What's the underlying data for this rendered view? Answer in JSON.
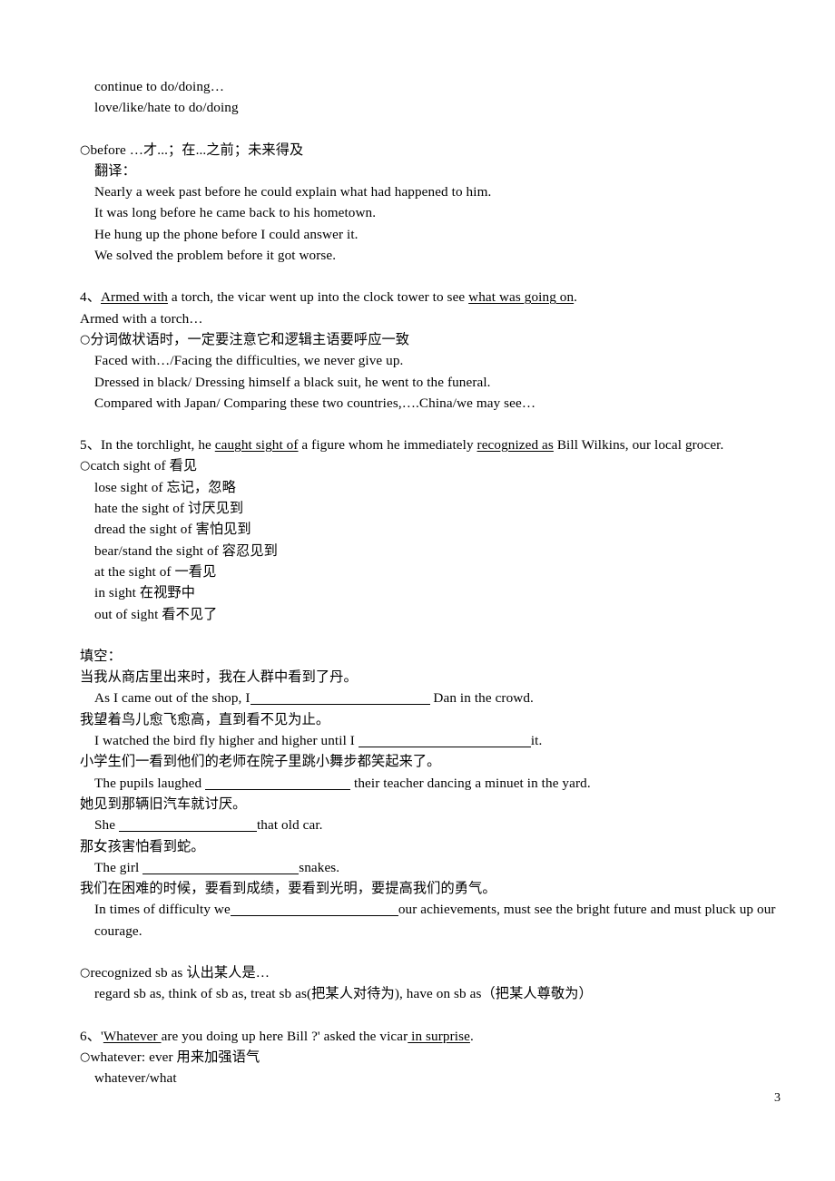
{
  "document": {
    "page_number": "3",
    "blocks": [
      {
        "id": "b1",
        "indent": 1,
        "text": "continue to do/doing…"
      },
      {
        "id": "b2",
        "indent": 1,
        "text": "love/like/hate to do/doing"
      },
      {
        "id": "b3",
        "indent": 0,
        "marker": "○",
        "text": "before …才...；在...之前；未来得及"
      },
      {
        "id": "b4",
        "indent": 1,
        "text": "翻译："
      },
      {
        "id": "b5",
        "indent": 1,
        "text": "Nearly a week past before he could explain what had happened to him."
      },
      {
        "id": "b6",
        "indent": 1,
        "text": "It was long before he came back to his hometown."
      },
      {
        "id": "b7",
        "indent": 1,
        "text": "He hung up the phone before I could answer it."
      },
      {
        "id": "b8",
        "indent": 1,
        "text": "We solved the problem before it got worse."
      },
      {
        "id": "b9",
        "indent": 0,
        "text": "4、Armed with a torch, the vicar went up into the clock tower to see what was going on."
      },
      {
        "id": "b10",
        "indent": 0,
        "text": "Armed with a torch…"
      },
      {
        "id": "b11",
        "indent": 0,
        "marker": "○",
        "text": "分词做状语时，一定要注意它和逻辑主语要呼应一致"
      },
      {
        "id": "b12",
        "indent": 1,
        "text": "Faced with…/Facing the difficulties, we never give up."
      },
      {
        "id": "b13",
        "indent": 1,
        "text": "Dressed in black/ Dressing himself a black suit, he went to the funeral."
      },
      {
        "id": "b14",
        "indent": 1,
        "text": "Compared with Japan/ Comparing these two countries,….China/we may see…"
      },
      {
        "id": "b15",
        "indent": 0,
        "text": "5、In the torchlight, he caught sight of a figure whom he immediately recognized as Bill Wilkins, our local grocer."
      },
      {
        "id": "b16",
        "indent": 0,
        "marker": "○",
        "text": "catch sight of 看见"
      },
      {
        "id": "b17",
        "indent": 1,
        "text": "lose sight of 忘记，忽略"
      },
      {
        "id": "b18",
        "indent": 1,
        "text": "hate the sight of 讨厌见到"
      },
      {
        "id": "b19",
        "indent": 1,
        "text": "dread the sight of 害怕见到"
      },
      {
        "id": "b20",
        "indent": 1,
        "text": "bear/stand the sight of 容忍见到"
      },
      {
        "id": "b21",
        "indent": 1,
        "text": "at the sight of 一看见"
      },
      {
        "id": "b22",
        "indent": 1,
        "text": "in sight 在视野中"
      },
      {
        "id": "b23",
        "indent": 1,
        "text": "out of sight 看不见了"
      },
      {
        "id": "b24",
        "indent": 0,
        "text": "填空："
      },
      {
        "id": "b25",
        "indent": 0,
        "text": "当我从商店里出来时，我在人群中看到了丹。"
      },
      {
        "id": "b26",
        "indent": 1,
        "text": "As I came out of the shop, I"
      },
      {
        "id": "b27",
        "indent": 0,
        "text": "我望着鸟儿愈飞愈高，直到看不见为止。"
      },
      {
        "id": "b28",
        "indent": 1,
        "text": "I watched the bird fly higher and higher until I "
      },
      {
        "id": "b29",
        "indent": 0,
        "text": "小学生们一看到他们的老师在院子里跳小舞步都笑起来了。"
      },
      {
        "id": "b30",
        "indent": 1,
        "text": "The pupils laughed "
      },
      {
        "id": "b31",
        "indent": 0,
        "text": "她见到那辆旧汽车就讨厌。"
      },
      {
        "id": "b32",
        "indent": 1,
        "text": "She "
      },
      {
        "id": "b33",
        "indent": 0,
        "text": "那女孩害怕看到蛇。"
      },
      {
        "id": "b34",
        "indent": 1,
        "text": "The girl "
      },
      {
        "id": "b35",
        "indent": 0,
        "text": "我们在困难的时候，要看到成绩，要看到光明，要提高我们的勇气。"
      },
      {
        "id": "b36",
        "indent": 1,
        "text": "In times of difficulty we"
      },
      {
        "id": "b37",
        "indent": 0,
        "marker": "○",
        "text": "recognized sb as 认出某人是…"
      },
      {
        "id": "b38",
        "indent": 1,
        "text": "regard sb as, think of sb as, treat sb as(把某人对待为), have on sb as（把某人尊敬为）"
      },
      {
        "id": "b39",
        "indent": 0,
        "text": "6、'Whatever are you doing up here Bill ?' asked the vicar in surprise."
      },
      {
        "id": "b40",
        "indent": 0,
        "marker": "○",
        "text": "whatever: ever 用来加强语气"
      },
      {
        "id": "b41",
        "indent": 1,
        "text": "whatever/what"
      }
    ],
    "lines": {
      "l1": "continue to do/doing…",
      "l2": "love/like/hate to do/doing",
      "l3_marker": "○",
      "l3": "before …才...；在...之前；未来得及",
      "l4": "翻译：",
      "l5": "Nearly a week past before he could explain what had happened to him.",
      "l6": "It was long before he came back to his hometown.",
      "l7": "He hung up the phone before I could answer it.",
      "l8": "We solved the problem before it got worse.",
      "s4_num": "4、",
      "s4_u1": "Armed with",
      "s4_mid": " a torch, the vicar went up into the clock tower to see ",
      "s4_u2": "what was going on",
      "s4_end": ".",
      "s4_line2": "Armed with a torch…",
      "s4_marker": "○",
      "s4_note": "分词做状语时，一定要注意它和逻辑主语要呼应一致",
      "s4_e1": "Faced with…/Facing the difficulties, we never give up.",
      "s4_e2": "Dressed in black/ Dressing himself a black suit, he went to the funeral.",
      "s4_e3": "Compared with Japan/ Comparing these two countries,….China/we may see…",
      "s5_num": "5、",
      "s5_p1": "In the torchlight, he ",
      "s5_u1": "caught sight of",
      "s5_p2": " a figure whom he immediately ",
      "s5_u2": "recognized as",
      "s5_p3": " Bill Wilkins, our local grocer.",
      "s5_marker": "○",
      "s5_head": "catch sight of 看见",
      "s5_i1": "lose sight of 忘记，忽略",
      "s5_i2": "hate the sight of 讨厌见到",
      "s5_i3": "dread the sight of 害怕见到",
      "s5_i4": "bear/stand the sight of 容忍见到",
      "s5_i5": "at the sight of 一看见",
      "s5_i6": "in sight 在视野中",
      "s5_i7": "out of sight 看不见了",
      "fill_title": "填空：",
      "q1_cn": "当我从商店里出来时，我在人群中看到了丹。",
      "q1_pre": "As I came out of the shop, I",
      "q1_post": " Dan in the crowd.",
      "q2_cn": "我望着鸟儿愈飞愈高，直到看不见为止。",
      "q2_pre": "I watched the bird fly higher and higher until I ",
      "q2_post": "it.",
      "q3_cn": "小学生们一看到他们的老师在院子里跳小舞步都笑起来了。",
      "q3_pre": "The pupils laughed ",
      "q3_post": " their teacher dancing a minuet in the yard.",
      "q4_cn": "她见到那辆旧汽车就讨厌。",
      "q4_pre": "She ",
      "q4_post": "that old car.",
      "q5_cn": "那女孩害怕看到蛇。",
      "q5_pre": "The girl ",
      "q5_post": "snakes.",
      "q6_cn": "我们在困难的时候，要看到成绩，要看到光明，要提高我们的勇气。",
      "q6_pre": "In times of difficulty we",
      "q6_post": "our achievements, must see the bright future and must pluck up our courage.",
      "rec_marker": "○",
      "rec_head": "recognized sb as 认出某人是…",
      "rec_list": "regard sb as, think of sb as, treat sb as(把某人对待为), have on sb as（把某人尊敬为）",
      "s6_num": "6、",
      "s6_q1": "'",
      "s6_u1": "Whatever ",
      "s6_mid": "are you doing up here Bill ?' asked the vicar",
      "s6_u2": " in surprise",
      "s6_end": ".",
      "s6_marker": "○",
      "s6_note": "whatever: ever 用来加强语气",
      "s6_sub": "whatever/what"
    }
  }
}
